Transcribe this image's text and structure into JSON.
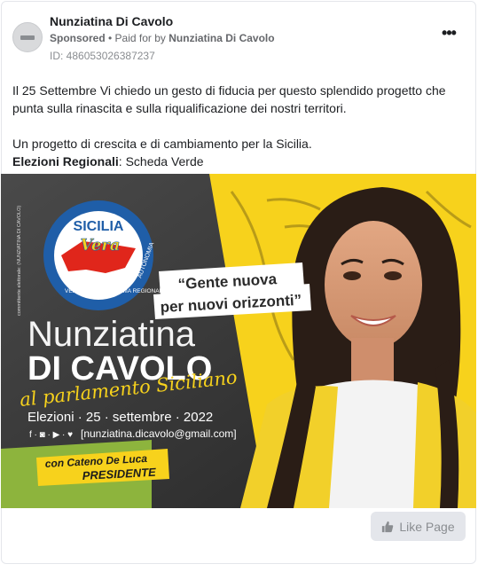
{
  "post": {
    "page_name": "Nunziatina Di Cavolo",
    "sponsored_label": "Sponsored",
    "separator": " • ",
    "paid_for_prefix": "Paid for by ",
    "paid_for_name": "Nunziatina Di Cavolo",
    "ad_id": "ID: 486053026387237",
    "more_glyph": "•••",
    "text_line1": "Il 25 Settembre Vi chiedo un gesto di fiducia per questo splendido progetto che punta sulla rinascita e sulla riqualificazione dei nostri territori.",
    "text_line2": "Un progetto di crescita e di cambiamento per la Sicilia.",
    "text_bold": "Elezioni Regionali",
    "text_after_bold": ": Scheda Verde"
  },
  "creative": {
    "side_note": "committente elettorale: (NUNZIATINA DI CAVOLO)",
    "logo_top": "SICILIA",
    "logo_script": "Vera",
    "logo_ring_left": "VERSO UNA ECONOMIA REGIONALE",
    "logo_ring_right": "AUTONOMIA",
    "quote_line1": "“Gente nuova",
    "quote_line2": "per nuovi orizzonti”",
    "first_name": "Nunziatina",
    "last_name": "DI CAVOLO",
    "tagline": "al parlamento Siciliano",
    "election_line": "Elezioni · 25 · settembre · 2022",
    "social_icons": "f · ◙ · ▶ · ♥",
    "email": "[nunziatina.dicavolo@gmail.com]",
    "with_label": "con Cateno De Luca",
    "president_label": "PRESIDENTE"
  },
  "actions": {
    "like_page_label": "Like Page",
    "like_icon": "thumbs-up-icon"
  },
  "colors": {
    "accent_yellow": "#f7d21c",
    "logo_blue": "#1f5ea8",
    "logo_red": "#e0261b",
    "green": "#8db43d",
    "muted": "#65676b"
  }
}
